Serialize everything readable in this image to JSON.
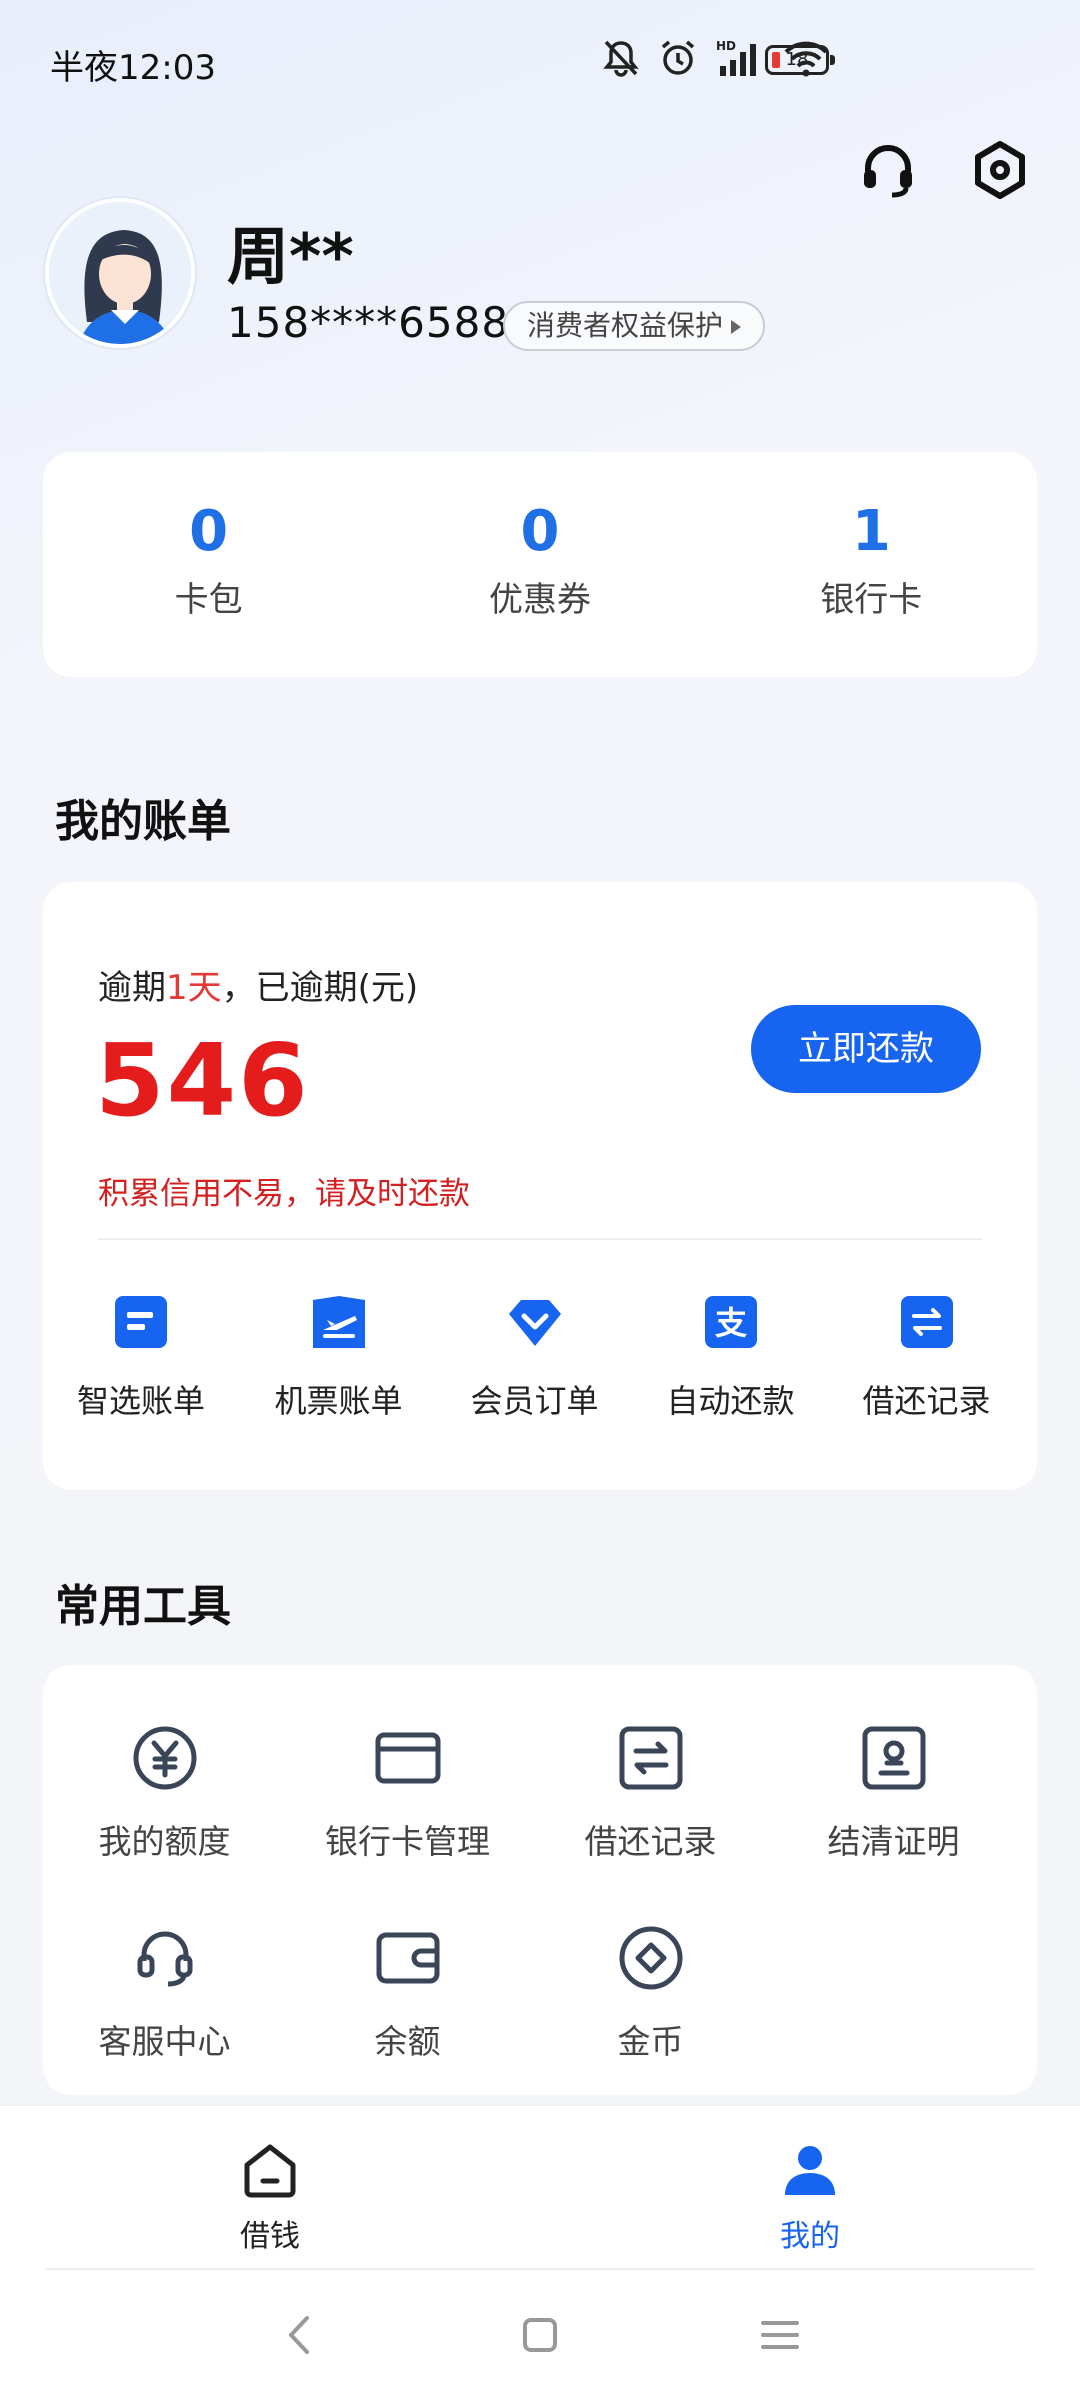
{
  "status_bar": {
    "time": "半夜12:03",
    "battery": "18"
  },
  "profile": {
    "name": "周**",
    "phone": "158****6588",
    "rights_label": "消费者权益保护"
  },
  "stats": [
    {
      "value": "0",
      "label": "卡包"
    },
    {
      "value": "0",
      "label": "优惠券"
    },
    {
      "value": "1",
      "label": "银行卡"
    }
  ],
  "bill_section": {
    "title": "我的账单",
    "overdue_prefix": "逾期",
    "overdue_days": "1天",
    "overdue_suffix": "，已逾期(元)",
    "amount": "546",
    "repay_button": "立即还款",
    "reminder": "积累信用不易，请及时还款",
    "tools": [
      {
        "icon": "doc-icon",
        "label": "智选账单"
      },
      {
        "icon": "plane-icon",
        "label": "机票账单"
      },
      {
        "icon": "diamond-icon",
        "label": "会员订单"
      },
      {
        "icon": "alipay-icon",
        "label": "自动还款"
      },
      {
        "icon": "exchange-icon",
        "label": "借还记录"
      }
    ]
  },
  "tools_section": {
    "title": "常用工具",
    "items": [
      {
        "icon": "yuan-icon",
        "label": "我的额度"
      },
      {
        "icon": "card-icon",
        "label": "银行卡管理"
      },
      {
        "icon": "exchange-icon",
        "label": "借还记录"
      },
      {
        "icon": "certificate-icon",
        "label": "结清证明"
      },
      {
        "icon": "headset-icon",
        "label": "客服中心"
      },
      {
        "icon": "wallet-icon",
        "label": "余额"
      },
      {
        "icon": "coin-icon",
        "label": "金币"
      }
    ]
  },
  "bottom_nav": [
    {
      "icon": "home-icon",
      "label": "借钱",
      "active": false
    },
    {
      "icon": "person-icon",
      "label": "我的",
      "active": true
    }
  ],
  "colors": {
    "accent": "#1764f0",
    "danger": "#e51c1c"
  }
}
